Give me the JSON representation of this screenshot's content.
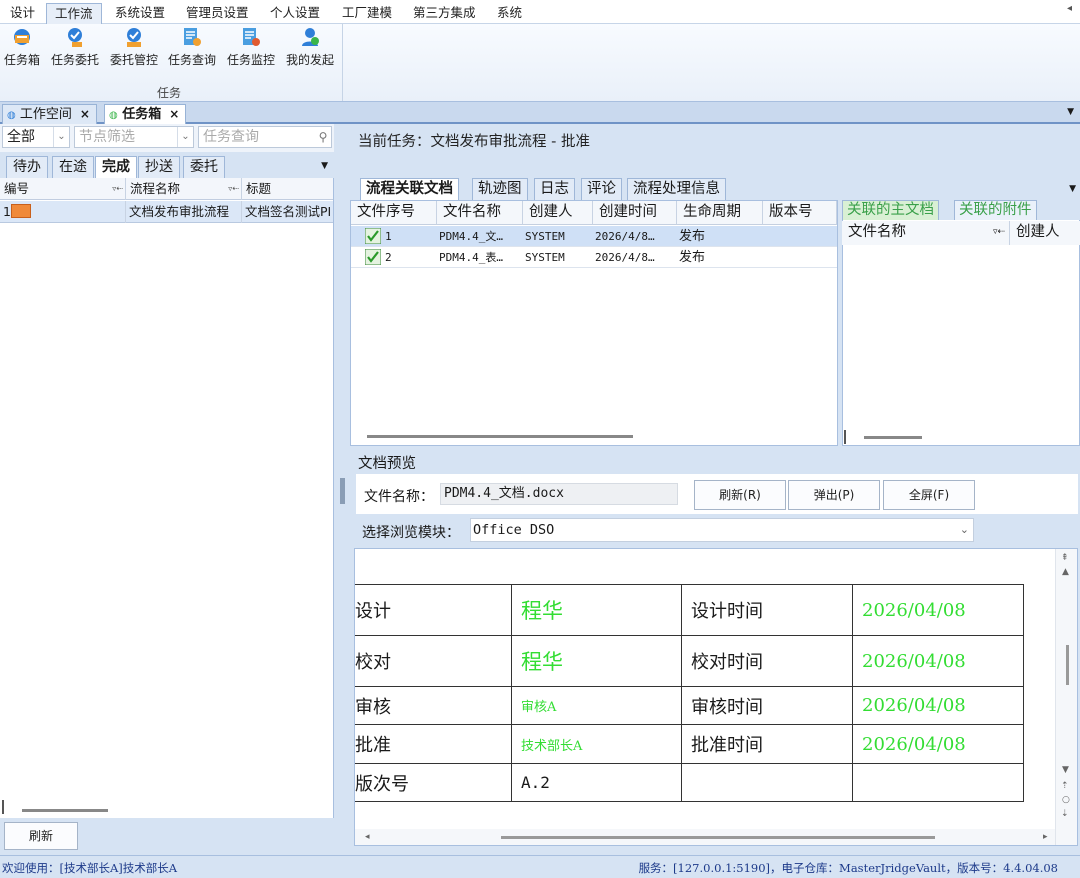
{
  "menu": {
    "items": [
      "设计",
      "工作流",
      "系统设置",
      "管理员设置",
      "个人设置",
      "工厂建模",
      "第三方集成",
      "系统"
    ],
    "active_index": 1
  },
  "ribbon": {
    "buttons": [
      {
        "label": "任务箱",
        "icon": "inbox-icon"
      },
      {
        "label": "任务委托",
        "icon": "delegate-icon"
      },
      {
        "label": "委托管控",
        "icon": "delegation-control-icon"
      },
      {
        "label": "任务查询",
        "icon": "task-query-icon"
      },
      {
        "label": "任务监控",
        "icon": "task-monitor-icon"
      },
      {
        "label": "我的发起",
        "icon": "my-initiated-icon"
      }
    ],
    "group_label": "任务"
  },
  "doc_tabs": [
    {
      "label": "工作空间",
      "active": false
    },
    {
      "label": "任务箱",
      "active": true
    }
  ],
  "left_panel": {
    "scope_filter": "全部",
    "node_filter_placeholder": "节点筛选",
    "task_search_placeholder": "任务查询",
    "subtabs": [
      "待办",
      "在途",
      "完成",
      "抄送",
      "委托"
    ],
    "active_subtab": "完成",
    "columns": [
      "编号",
      "流程名称",
      "标题"
    ],
    "rows": [
      {
        "no": "1",
        "process": "文档发布审批流程",
        "title": "文档签名测试PI"
      }
    ],
    "refresh_button": "刷新"
  },
  "current_task": "当前任务：文档发布审批流程 - 批准",
  "right_tabs": [
    "流程关联文档",
    "轨迹图",
    "日志",
    "评论",
    "流程处理信息"
  ],
  "active_right_tab": "流程关联文档",
  "file_list": {
    "columns": [
      "文件序号",
      "文件名称",
      "创建人",
      "创建时间",
      "生命周期",
      "版本号"
    ],
    "rows": [
      {
        "no": "1",
        "name": "PDM4.4_文…",
        "creator": "SYSTEM",
        "created": "2026/4/8…",
        "lifecycle": "发布",
        "version": ""
      },
      {
        "no": "2",
        "name": "PDM4.4_表…",
        "creator": "SYSTEM",
        "created": "2026/4/8…",
        "lifecycle": "发布",
        "version": ""
      }
    ]
  },
  "assoc": {
    "tabs": [
      "关联的主文档",
      "关联的附件"
    ],
    "columns": [
      "文件名称",
      "创建人"
    ]
  },
  "preview": {
    "title": "文档预览",
    "file_name_label": "文件名称：",
    "file_name": "PDM4.4_文档.docx",
    "refresh_button": "刷新(R)",
    "popup_button": "弹出(P)",
    "fullscreen_button": "全屏(F)",
    "module_label": "选择浏览模块：",
    "module_value": "Office DSO"
  },
  "document_table": [
    {
      "label": "设计",
      "value": "程华",
      "time_label": "设计时间",
      "time": "2026/04/08"
    },
    {
      "label": "校对",
      "value": "程华",
      "time_label": "校对时间",
      "time": "2026/04/08"
    },
    {
      "label": "审核",
      "value": "审核A",
      "time_label": "审核时间",
      "time": "2026/04/08"
    },
    {
      "label": "批准",
      "value": "技术部长A",
      "time_label": "批准时间",
      "time": "2026/04/08"
    },
    {
      "label": "版次号",
      "value": "A.2",
      "time_label": "",
      "time": ""
    }
  ],
  "status": {
    "left": "欢迎使用：[技术部长A]技术部长A",
    "right": "服务：[127.0.0.1:5190]，电子仓库：MasterJridgeVault，版本号：4.4.04.08"
  },
  "colors": {
    "accent_blue": "#d6e3f3",
    "sign_green": "#33dd33",
    "status_text": "#1d3a8a"
  }
}
